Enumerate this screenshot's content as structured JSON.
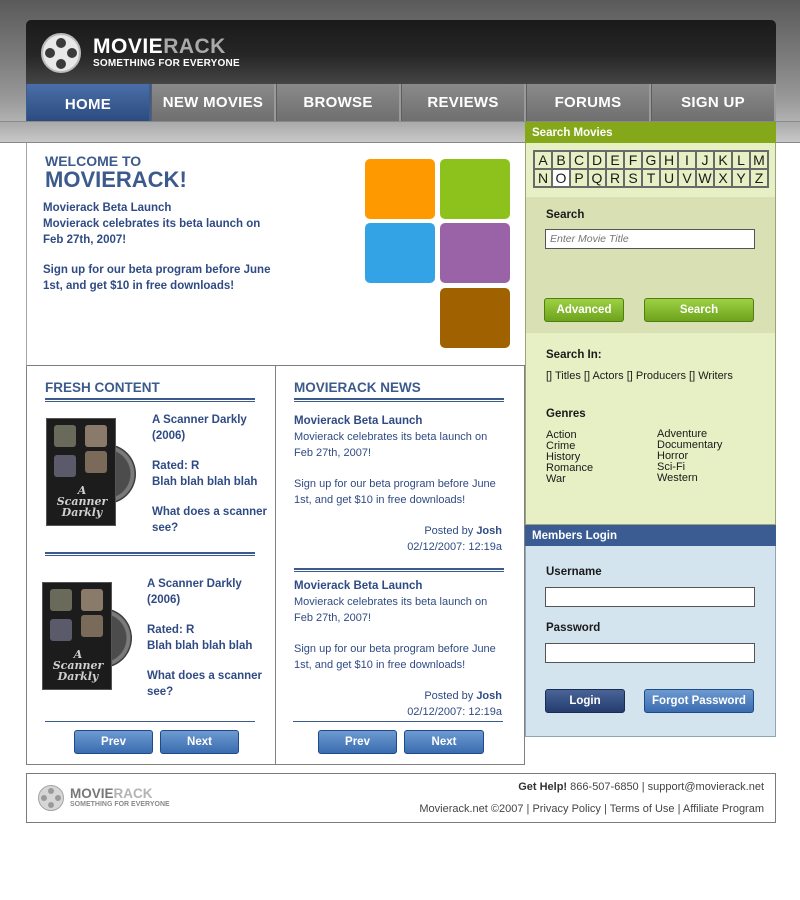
{
  "brand": {
    "name_a": "MOVIE",
    "name_b": "RACK",
    "tagline": "SOMETHING FOR EVERYONE"
  },
  "nav": [
    "HOME",
    "NEW MOVIES",
    "BROWSE",
    "REVIEWS",
    "FORUMS",
    "SIGN UP"
  ],
  "hero": {
    "welcome_small": "WELCOME TO",
    "welcome_big": "MOVIERACK!",
    "line1": "Movierack Beta Launch",
    "line2": "Movierack celebrates its beta launch on Feb 27th, 2007!",
    "line3": "Sign up for our beta program before June 1st, and get $10 in free downloads!",
    "tile_colors": [
      "#ff9900",
      "#8dc21d",
      "#33a3e6",
      "#9a63a8",
      "#a06200"
    ]
  },
  "fresh": {
    "title": "FRESH CONTENT",
    "cover_text": "A Scanner Darkly",
    "items": [
      {
        "title": "A Scanner Darkly (2006)",
        "rating": "Rated: R",
        "desc": "Blah blah blah blah",
        "question": "What does a scanner see?"
      },
      {
        "title": "A Scanner Darkly (2006)",
        "rating": "Rated: R",
        "desc": "Blah blah blah blah",
        "question": "What does a scanner see?"
      }
    ],
    "prev": "Prev",
    "next": "Next"
  },
  "news": {
    "title": "MOVIERACK NEWS",
    "items": [
      {
        "title": "Movierack Beta Launch",
        "body1": "Movierack celebrates its beta launch on Feb 27th, 2007!",
        "body2": "Sign up for our beta program before June 1st, and get $10 in free downloads!",
        "posted_by_label": "Posted by",
        "author": "Josh",
        "date": "02/12/2007: 12:19a"
      },
      {
        "title": "Movierack Beta Launch",
        "body1": "Movierack celebrates its beta launch on Feb 27th, 2007!",
        "body2": "Sign up for our beta program before June 1st, and get $10 in free downloads!",
        "posted_by_label": "Posted by",
        "author": "Josh",
        "date": "02/12/2007: 12:19a"
      }
    ],
    "prev": "Prev",
    "next": "Next"
  },
  "search": {
    "header": "Search Movies",
    "letters": [
      "A",
      "B",
      "C",
      "D",
      "E",
      "F",
      "G",
      "H",
      "I",
      "J",
      "K",
      "L",
      "M",
      "N",
      "O",
      "P",
      "Q",
      "R",
      "S",
      "T",
      "U",
      "V",
      "W",
      "X",
      "Y",
      "Z"
    ],
    "selected_letter": "O",
    "label": "Search",
    "placeholder": "Enter Movie Title",
    "advanced_button": "Advanced",
    "search_button": "Search",
    "search_in_label": "Search In:",
    "search_in_options": "[] Titles [] Actors [] Producers [] Writers",
    "genres_label": "Genres",
    "genres_left": [
      "Action",
      "Crime",
      "History",
      "Romance",
      "War"
    ],
    "genres_right": [
      "Adventure",
      "Documentary",
      "Horror",
      "Sci-Fi",
      "Western"
    ]
  },
  "login": {
    "header": "Members Login",
    "username_label": "Username",
    "password_label": "Password",
    "login_button": "Login",
    "forgot_button": "Forgot Password"
  },
  "footer": {
    "help_label": "Get Help!",
    "phone": "866-507-6850",
    "email": "support@movierack.net",
    "copyright": "Movierack.net ©2007",
    "links": [
      "Privacy Policy",
      "Terms of Use",
      "Affiliate Program"
    ]
  }
}
